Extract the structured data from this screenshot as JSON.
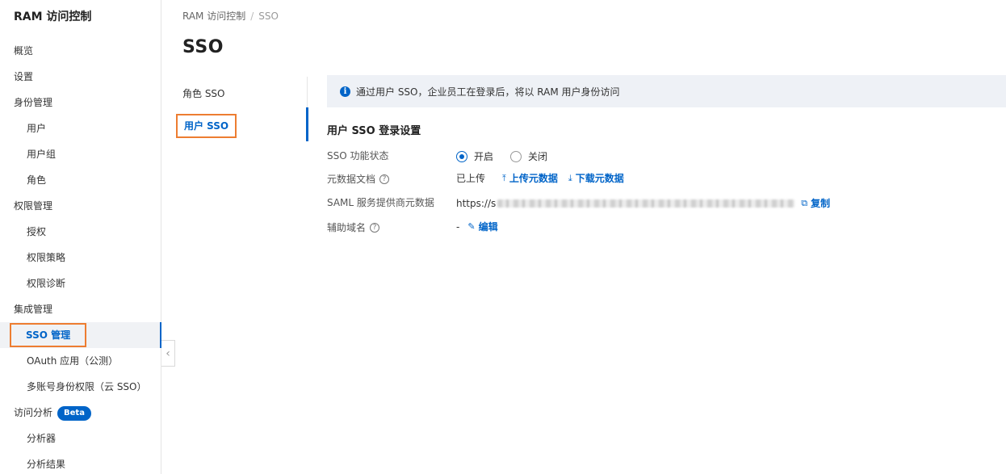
{
  "app": {
    "title": "RAM 访问控制"
  },
  "sidebar": {
    "items": [
      {
        "label": "概览"
      },
      {
        "label": "设置"
      },
      {
        "label": "身份管理"
      },
      {
        "label": "用户"
      },
      {
        "label": "用户组"
      },
      {
        "label": "角色"
      },
      {
        "label": "权限管理"
      },
      {
        "label": "授权"
      },
      {
        "label": "权限策略"
      },
      {
        "label": "权限诊断"
      },
      {
        "label": "集成管理"
      },
      {
        "label": "SSO 管理"
      },
      {
        "label": "OAuth 应用（公测）"
      },
      {
        "label": "多账号身份权限（云 SSO）"
      },
      {
        "label": "访问分析",
        "badge": "Beta"
      },
      {
        "label": "分析器"
      },
      {
        "label": "分析结果"
      }
    ]
  },
  "breadcrumb": {
    "root": "RAM 访问控制",
    "separator": "/",
    "current": "SSO"
  },
  "page": {
    "title": "SSO"
  },
  "tabs": [
    {
      "label": "角色 SSO"
    },
    {
      "label": "用户 SSO"
    }
  ],
  "notice": {
    "text": "通过用户 SSO，企业员工在登录后，将以 RAM 用户身份访问"
  },
  "section": {
    "title": "用户 SSO 登录设置",
    "rows": [
      {
        "label": "SSO 功能状态",
        "options": [
          "开启",
          "关闭"
        ],
        "selected": "开启"
      },
      {
        "label": "元数据文档",
        "status": "已上传",
        "upload": "上传元数据",
        "download": "下载元数据"
      },
      {
        "label": "SAML 服务提供商元数据",
        "url_prefix": "https://s",
        "copy": "复制"
      },
      {
        "label": "辅助域名",
        "value": "-",
        "edit": "编辑"
      }
    ]
  },
  "colors": {
    "accent": "#0064c8",
    "highlight_box": "#ed7d31",
    "notice_bg": "#eef1f6"
  },
  "icons": {
    "info": "info-icon",
    "help": "question-circle-icon",
    "upload": "upload-icon",
    "download": "download-icon",
    "copy": "copy-icon",
    "edit": "edit-icon",
    "collapse": "chevron-left-icon"
  }
}
